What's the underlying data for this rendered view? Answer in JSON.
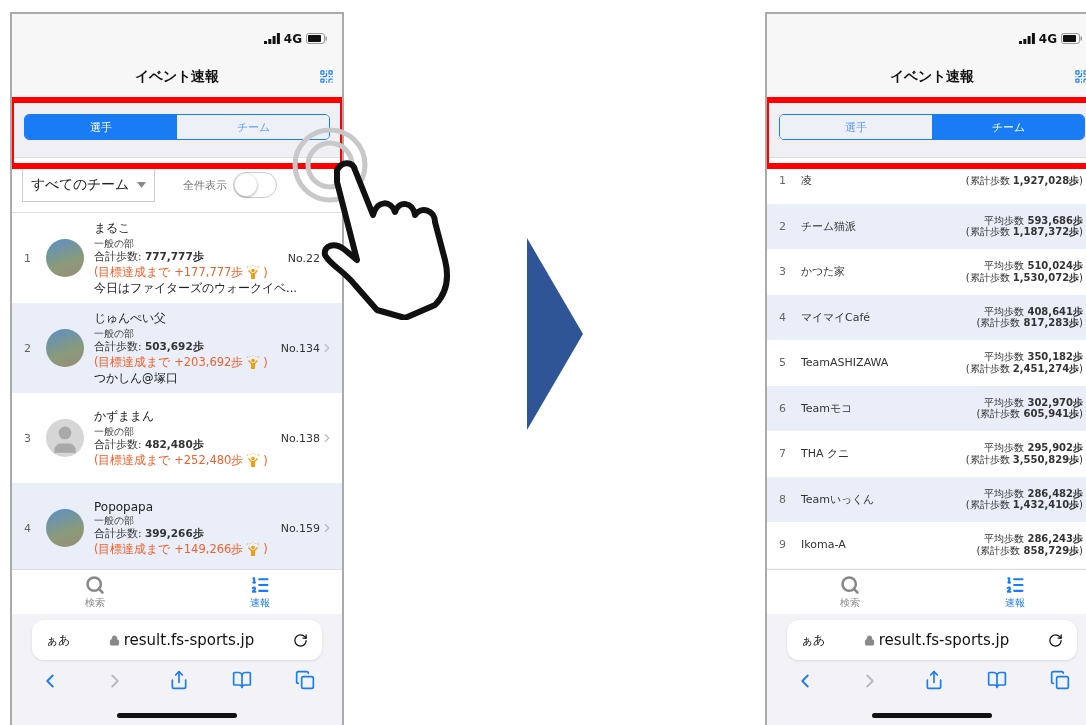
{
  "screens": [
    {
      "status": {
        "network": "4G"
      },
      "title": "イベント速報",
      "highlight": true,
      "tap_gesture": true,
      "segments": [
        {
          "label": "選手",
          "selected": true
        },
        {
          "label": "チーム",
          "selected": false
        }
      ],
      "filter": {
        "dropdown": "すべてのチーム",
        "toggle_label": "全件表示",
        "toggle_on": false
      },
      "players": [
        {
          "rank": "1",
          "kind": "photo",
          "name": "まるこ",
          "division": "一般の部",
          "total_label": "合計歩数:",
          "total": "777,777歩",
          "goal": "(目標達成まで +177,777歩",
          "goal_end": ")",
          "comment": "今日はファイターズのウォークイベ...",
          "number": "No.22"
        },
        {
          "rank": "2",
          "kind": "photo",
          "name": "じゅんぺい父",
          "division": "一般の部",
          "total_label": "合計歩数:",
          "total": "503,692歩",
          "goal": "(目標達成まで +203,692歩",
          "goal_end": ")",
          "comment": "つかしん@塚口",
          "number": "No.134"
        },
        {
          "rank": "3",
          "kind": "default",
          "name": "かずままん",
          "division": "一般の部",
          "total_label": "合計歩数:",
          "total": "482,480歩",
          "goal": "(目標達成まで +252,480歩",
          "goal_end": ")",
          "number": "No.138"
        },
        {
          "rank": "4",
          "kind": "photo",
          "name": "Popopapa",
          "division": "一般の部",
          "total_label": "合計歩数:",
          "total": "399,266歩",
          "goal": "(目標達成まで +149,266歩",
          "goal_end": ")",
          "number": "No.159"
        }
      ],
      "tabbar": [
        {
          "label": "検索",
          "kind": "search",
          "selected": false
        },
        {
          "label": "速報",
          "kind": "ranking",
          "selected": true
        }
      ],
      "browser": {
        "text_size": "ぁあ",
        "url": "result.fs-sports.jp",
        "toolbar": [
          {
            "kind": "back",
            "disabled": false
          },
          {
            "kind": "forward",
            "disabled": true
          },
          {
            "kind": "share",
            "disabled": false
          },
          {
            "kind": "bookmarks",
            "disabled": false
          },
          {
            "kind": "tabs",
            "disabled": false
          }
        ]
      }
    },
    {
      "status": {
        "network": "4G"
      },
      "title": "イベント速報",
      "highlight": true,
      "segments": [
        {
          "label": "選手",
          "selected": false
        },
        {
          "label": "チーム",
          "selected": true
        }
      ],
      "teams": [
        {
          "rank": "1",
          "name": "凌",
          "total": "(累計歩数 **1,927,028歩**)"
        },
        {
          "rank": "2",
          "name": "チーム猫派",
          "average": "平均歩数 **593,686歩**",
          "total": "(累計歩数 **1,187,372歩**)"
        },
        {
          "rank": "3",
          "name": "かつた家",
          "average": "平均歩数 **510,024歩**",
          "total": "(累計歩数 **1,530,072歩**)"
        },
        {
          "rank": "4",
          "name": "マイマイCafé",
          "average": "平均歩数 **408,641歩**",
          "total": "(累計歩数 **817,283歩**)"
        },
        {
          "rank": "5",
          "name": "TeamASHIZAWA",
          "average": "平均歩数 **350,182歩**",
          "total": "(累計歩数 **2,451,274歩**)"
        },
        {
          "rank": "6",
          "name": "Teamモコ",
          "average": "平均歩数 **302,970歩**",
          "total": "(累計歩数 **605,941歩**)"
        },
        {
          "rank": "7",
          "name": "THA クニ",
          "average": "平均歩数 **295,902歩**",
          "total": "(累計歩数 **3,550,829歩**)"
        },
        {
          "rank": "8",
          "name": "Teamいっくん",
          "average": "平均歩数 **286,482歩**",
          "total": "(累計歩数 **1,432,410歩**)"
        },
        {
          "rank": "9",
          "name": "Ikoma-A",
          "average": "平均歩数 **286,243歩**",
          "total": "(累計歩数 **858,729歩**)"
        }
      ],
      "tabbar": [
        {
          "label": "検索",
          "kind": "search",
          "selected": false
        },
        {
          "label": "速報",
          "kind": "ranking",
          "selected": true
        }
      ],
      "browser": {
        "text_size": "ぁあ",
        "url": "result.fs-sports.jp",
        "toolbar": [
          {
            "kind": "back",
            "disabled": false
          },
          {
            "kind": "forward",
            "disabled": true
          },
          {
            "kind": "share",
            "disabled": false
          },
          {
            "kind": "bookmarks",
            "disabled": false
          },
          {
            "kind": "tabs",
            "disabled": false
          }
        ]
      }
    }
  ]
}
